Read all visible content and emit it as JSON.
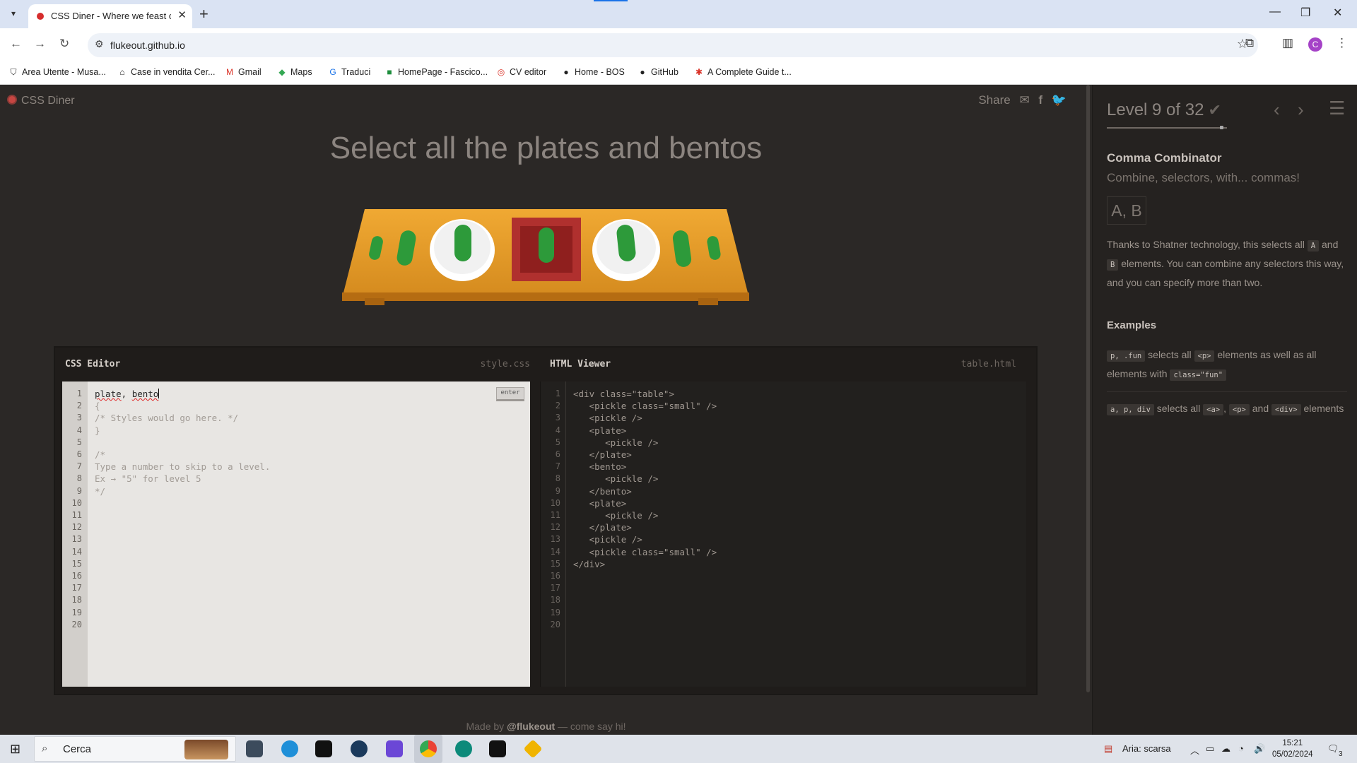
{
  "browser": {
    "tab_title": "CSS Diner - Where we feast on",
    "url": "flukeout.github.io",
    "bookmarks": [
      {
        "icon": "shield-icon",
        "label": "Area Utente - Musa..."
      },
      {
        "icon": "house-icon",
        "label": "Case in vendita Cer..."
      },
      {
        "icon": "gmail-icon",
        "label": "Gmail"
      },
      {
        "icon": "maps-icon",
        "label": "Maps"
      },
      {
        "icon": "translate-icon",
        "label": "Traduci"
      },
      {
        "icon": "bookmark-green-icon",
        "label": "HomePage - Fascico..."
      },
      {
        "icon": "cv-icon",
        "label": "CV editor"
      },
      {
        "icon": "bos-icon",
        "label": "Home - BOS"
      },
      {
        "icon": "github-icon",
        "label": "GitHub"
      },
      {
        "icon": "asterisk-icon",
        "label": "A Complete Guide t..."
      }
    ],
    "profile_initial": "C"
  },
  "app": {
    "logo": "CSS Diner",
    "share_label": "Share",
    "instruction": "Select all the plates and bentos",
    "footer_prefix": "Made by ",
    "footer_author": "@flukeout",
    "footer_suffix": " — come say hi!"
  },
  "css_editor": {
    "title": "CSS Editor",
    "filename": "style.css",
    "enter_label": "enter",
    "input_value": "plate, bento",
    "lines": [
      "",
      "{",
      "/* Styles would go here. */",
      "}",
      "",
      "/*",
      "Type a number to skip to a level.",
      "Ex → \"5\" for level 5",
      "*/",
      "",
      "",
      "",
      "",
      "",
      "",
      "",
      "",
      "",
      "",
      ""
    ],
    "line_numbers": [
      "1",
      "2",
      "3",
      "4",
      "5",
      "6",
      "7",
      "8",
      "9",
      "10",
      "11",
      "12",
      "13",
      "14",
      "15",
      "16",
      "17",
      "18",
      "19",
      "20"
    ]
  },
  "html_viewer": {
    "title": "HTML Viewer",
    "filename": "table.html",
    "lines": [
      "<div class=\"table\">",
      "   <pickle class=\"small\" />",
      "   <pickle />",
      "   <plate>",
      "      <pickle />",
      "   </plate>",
      "   <bento>",
      "      <pickle />",
      "   </bento>",
      "   <plate>",
      "      <pickle />",
      "   </plate>",
      "   <pickle />",
      "   <pickle class=\"small\" />",
      "</div>",
      "",
      "",
      "",
      "",
      ""
    ],
    "line_numbers": [
      "1",
      "2",
      "3",
      "4",
      "5",
      "6",
      "7",
      "8",
      "9",
      "10",
      "11",
      "12",
      "13",
      "14",
      "15",
      "16",
      "17",
      "18",
      "19",
      "20"
    ]
  },
  "sidebar": {
    "level_text": "Level 9 of 32",
    "level_current": 9,
    "level_total": 32,
    "section_title": "Comma Combinator",
    "section_subtitle": "Combine, selectors, with... commas!",
    "syntax": "A, B",
    "desc_1": "Thanks to Shatner technology, this selects all ",
    "desc_code_a": "A",
    "desc_2": " and ",
    "desc_code_b": "B",
    "desc_3": " elements. You can combine any selectors this way, and you can specify more than two.",
    "examples_title": "Examples",
    "ex1_code": "p, .fun",
    "ex1_t1": " selects all ",
    "ex1_code2": "<p>",
    "ex1_t2": " elements as well as all elements with ",
    "ex1_code3": "class=\"fun\"",
    "ex2_code": "a, p, div",
    "ex2_t1": " selects all ",
    "ex2_code2": "<a>",
    "ex2_t2": ", ",
    "ex2_code3": "<p>",
    "ex2_t3": " and ",
    "ex2_code4": "<div>",
    "ex2_t4": " elements"
  },
  "taskbar": {
    "search_placeholder": "Cerca",
    "weather": "Aria: scarsa",
    "time": "15:21",
    "date": "05/02/2024",
    "notifications": "3"
  },
  "colors": {
    "background": "#2b2826",
    "table": "#e29a2b",
    "pickle": "#2d9a3a",
    "bento": "#b0302e",
    "plate": "#ffffff"
  }
}
